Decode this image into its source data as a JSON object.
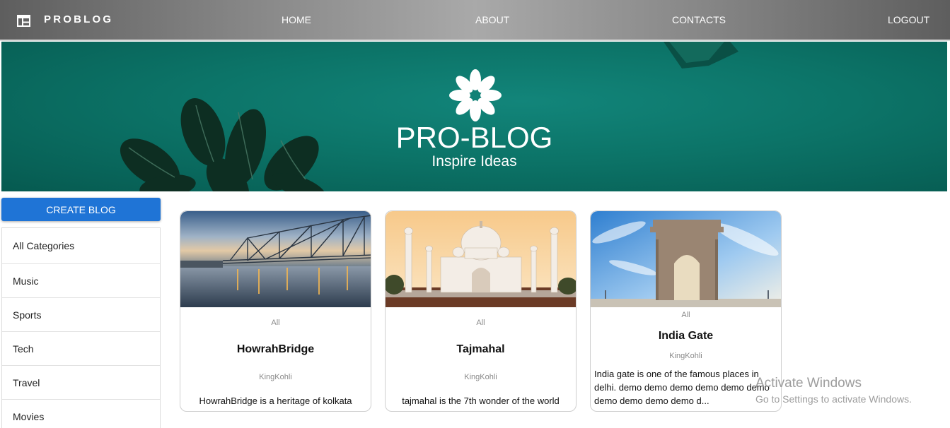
{
  "navbar": {
    "brand": "PROBLOG",
    "logo_icon": "table-layout-icon",
    "links": [
      "HOME",
      "ABOUT",
      "CONTACTS",
      "LOGOUT"
    ]
  },
  "banner": {
    "title": "PRO-BLOG",
    "subtitle": "Inspire Ideas",
    "icon": "flower-icon"
  },
  "sidebar": {
    "create_label": "CREATE BLOG",
    "categories": [
      "All Categories",
      "Music",
      "Sports",
      "Tech",
      "Travel",
      "Movies"
    ]
  },
  "posts": [
    {
      "category": "All",
      "title": "HowrahBridge",
      "author": "KingKohli",
      "description": "HowrahBridge is a heritage of kolkata"
    },
    {
      "category": "All",
      "title": "Tajmahal",
      "author": "KingKohli",
      "description": "tajmahal is the 7th wonder of the world"
    },
    {
      "category": "All",
      "title": "India Gate",
      "author": "KingKohli",
      "description": "India gate is one of the famous places in delhi. demo demo demo demo demo demo demo demo demo demo d..."
    }
  ],
  "watermark": {
    "line1": "Activate Windows",
    "line2": "Go to Settings to activate Windows."
  },
  "colors": {
    "accent": "#1f74d6",
    "banner": "#0c7468"
  }
}
